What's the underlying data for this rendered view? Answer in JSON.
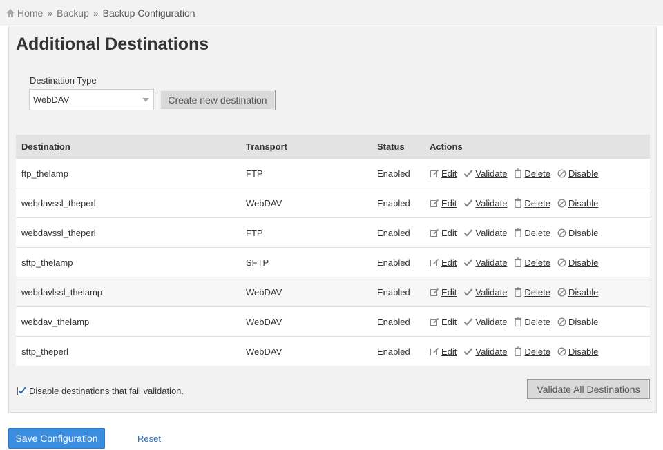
{
  "breadcrumb": {
    "home": "Home",
    "backup": "Backup",
    "current": "Backup Configuration",
    "separator": "»"
  },
  "section": {
    "title": "Additional Destinations",
    "destination_type_label": "Destination Type",
    "destination_type_value": "WebDAV",
    "create_button": "Create new destination"
  },
  "table": {
    "headers": {
      "destination": "Destination",
      "transport": "Transport",
      "status": "Status",
      "actions": "Actions"
    },
    "action_labels": {
      "edit": "Edit",
      "validate": "Validate",
      "delete": "Delete",
      "disable": "Disable"
    },
    "rows": [
      {
        "destination": "ftp_thelamp",
        "transport": "FTP",
        "status": "Enabled"
      },
      {
        "destination": "webdavssl_theperl",
        "transport": "WebDAV",
        "status": "Enabled"
      },
      {
        "destination": "webdavssl_theperl",
        "transport": "FTP",
        "status": "Enabled"
      },
      {
        "destination": "sftp_thelamp",
        "transport": "SFTP",
        "status": "Enabled"
      },
      {
        "destination": "webdavlssl_thelamp",
        "transport": "WebDAV",
        "status": "Enabled"
      },
      {
        "destination": "webdav_thelamp",
        "transport": "WebDAV",
        "status": "Enabled"
      },
      {
        "destination": "sftp_theperl",
        "transport": "WebDAV",
        "status": "Enabled"
      }
    ]
  },
  "footer": {
    "disable_failing_label": "Disable destinations that fail validation.",
    "disable_failing_checked": true,
    "validate_all_button": "Validate All Destinations",
    "save_button": "Save Configuration",
    "reset_link": "Reset"
  },
  "colors": {
    "primary_button": "#3b8de0",
    "link": "#2a6fb8",
    "panel_bg": "#f2f2f2"
  },
  "icons": {
    "home": "home-icon",
    "edit": "edit-icon",
    "validate": "check-icon",
    "delete": "trash-icon",
    "disable": "disable-icon",
    "dropdown": "chevron-down-icon"
  }
}
